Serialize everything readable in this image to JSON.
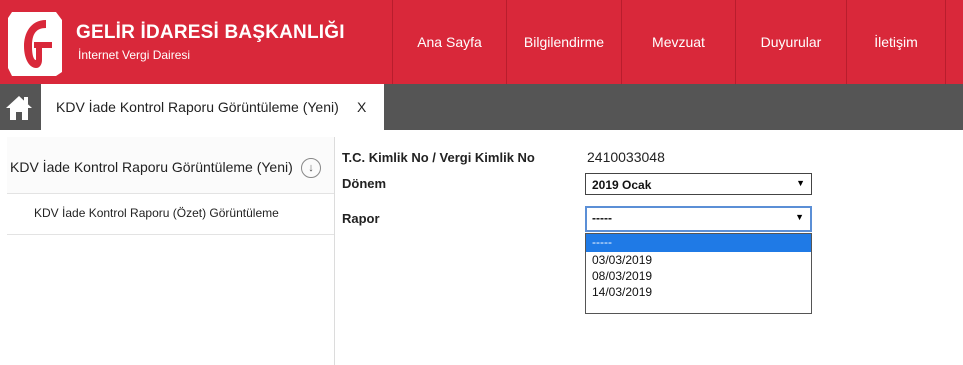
{
  "header": {
    "brand_title": "GELİR İDARESİ BAŞKANLIĞI",
    "brand_subtitle": "İnternet Vergi Dairesi",
    "logo_icon": "gib-logo-icon",
    "color": "#d9283a",
    "nav": [
      {
        "label": "Ana Sayfa"
      },
      {
        "label": "Bilgilendirme"
      },
      {
        "label": "Mevzuat"
      },
      {
        "label": "Duyurular"
      },
      {
        "label": "İletişim"
      }
    ]
  },
  "tabbar": {
    "home_icon": "home-icon",
    "tab_label": "KDV İade Kontrol Raporu Görüntüleme (Yeni)",
    "close_label": "X"
  },
  "sidebar": {
    "items": [
      {
        "label": "KDV İade Kontrol Raporu Görüntüleme (Yeni)",
        "icon": "arrow-down-circle-icon"
      },
      {
        "label": "KDV İade Kontrol Raporu (Özet) Görüntüleme"
      }
    ]
  },
  "form": {
    "tc_label": "T.C. Kimlik No / Vergi Kimlik No",
    "tc_value": "2410033048",
    "donem_label": "Dönem",
    "donem_value": "2019 Ocak",
    "rapor_label": "Rapor",
    "rapor_value": "-----",
    "rapor_options": [
      "-----",
      "03/03/2019",
      "08/03/2019",
      "14/03/2019"
    ],
    "selected_option": "-----",
    "accent": "#1f7ae6"
  }
}
